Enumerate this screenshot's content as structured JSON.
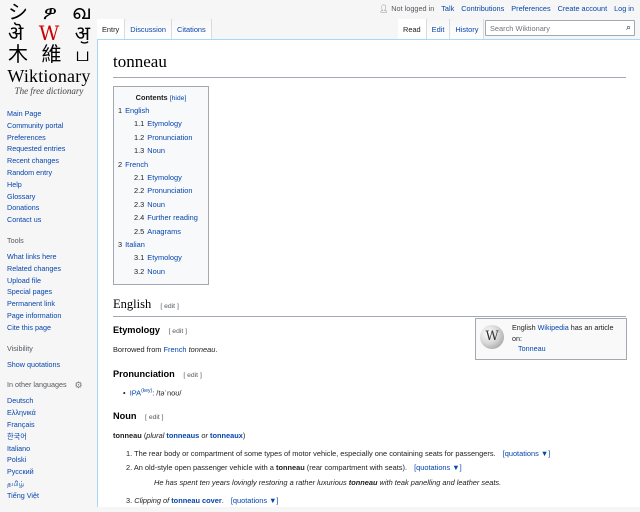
{
  "logo": {
    "glyph_rows": [
      [
        "シ",
        "ዎ",
        "ഖ"
      ],
      [
        "ऄ",
        "W",
        "ॶ"
      ],
      [
        "木",
        "維",
        "ப"
      ]
    ],
    "wordmark": "Wiktionary",
    "tagline": "The free dictionary"
  },
  "sidebar": {
    "navigation": [
      "Main Page",
      "Community portal",
      "Preferences",
      "Requested entries",
      "Recent changes",
      "Random entry",
      "Help",
      "Glossary",
      "Donations",
      "Contact us"
    ],
    "tools_heading": "Tools",
    "tools": [
      "What links here",
      "Related changes",
      "Upload file",
      "Special pages",
      "Permanent link",
      "Page information",
      "Cite this page"
    ],
    "visibility_heading": "Visibility",
    "visibility": [
      "Show quotations"
    ],
    "languages_heading": "In other languages",
    "languages": [
      "Deutsch",
      "Ελληνικά",
      "Français",
      "한국어",
      "Italiano",
      "Polski",
      "Русский",
      "தமிழ்",
      "Tiếng Việt"
    ]
  },
  "personal": {
    "not_logged_in": "Not logged in",
    "talk": "Talk",
    "contributions": "Contributions",
    "preferences": "Preferences",
    "create_account": "Create account",
    "log_in": "Log in"
  },
  "tabs": {
    "left": [
      "Entry",
      "Discussion",
      "Citations"
    ],
    "right": [
      "Read",
      "Edit",
      "History"
    ]
  },
  "search": {
    "placeholder": "Search Wiktionary"
  },
  "page": {
    "title": "tonneau",
    "toc": {
      "title": "Contents",
      "hide": "[hide]",
      "items": [
        {
          "num": "1",
          "text": "English",
          "level": 1
        },
        {
          "num": "1.1",
          "text": "Etymology",
          "level": 2
        },
        {
          "num": "1.2",
          "text": "Pronunciation",
          "level": 2
        },
        {
          "num": "1.3",
          "text": "Noun",
          "level": 2
        },
        {
          "num": "2",
          "text": "French",
          "level": 1
        },
        {
          "num": "2.1",
          "text": "Etymology",
          "level": 2
        },
        {
          "num": "2.2",
          "text": "Pronunciation",
          "level": 2
        },
        {
          "num": "2.3",
          "text": "Noun",
          "level": 2
        },
        {
          "num": "2.4",
          "text": "Further reading",
          "level": 2
        },
        {
          "num": "2.5",
          "text": "Anagrams",
          "level": 2
        },
        {
          "num": "3",
          "text": "Italian",
          "level": 1
        },
        {
          "num": "3.1",
          "text": "Etymology",
          "level": 2
        },
        {
          "num": "3.2",
          "text": "Noun",
          "level": 2
        }
      ]
    },
    "edit_label": "[ edit ]",
    "english_heading": "English",
    "etymology_heading": "Etymology",
    "etymology_prefix": "Borrowed from ",
    "etymology_link": "French",
    "etymology_term": "tonneau",
    "etymology_suffix": ".",
    "wikipedia_box": {
      "prefix": "English ",
      "link": "Wikipedia",
      "suffix": " has an article on:",
      "article": "Tonneau"
    },
    "pronunciation_heading": "Pronunciation",
    "ipa_label": "IPA",
    "ipa_key": "(key)",
    "ipa_value": ": /təˈnoʊ/",
    "noun_heading": "Noun",
    "headword": "tonneau",
    "plural_open": "(",
    "plural_label": "plural",
    "plural_1": "tonneaus",
    "plural_or": "or",
    "plural_2": "tonneaux",
    "plural_close": ")",
    "definitions": [
      {
        "num": "1.",
        "text": "The rear body or compartment of some types of motor vehicle, especially one containing seats for passengers.",
        "quotations": "[quotations ▼]"
      },
      {
        "num": "2.",
        "before": "An old-style open passenger vehicle with a ",
        "bold": "tonneau",
        "after": " (rear compartment with seats).",
        "quotations": "[quotations ▼]",
        "quote_before": "He has spent ten years lovingly restoring a rather luxurious ",
        "quote_bold": "tonneau",
        "quote_after": " with teak panelling and leather seats."
      },
      {
        "num": "3.",
        "clipping": "Clipping of",
        "link": "tonneau cover",
        "after": ".",
        "quotations": "[quotations ▼]"
      }
    ]
  }
}
